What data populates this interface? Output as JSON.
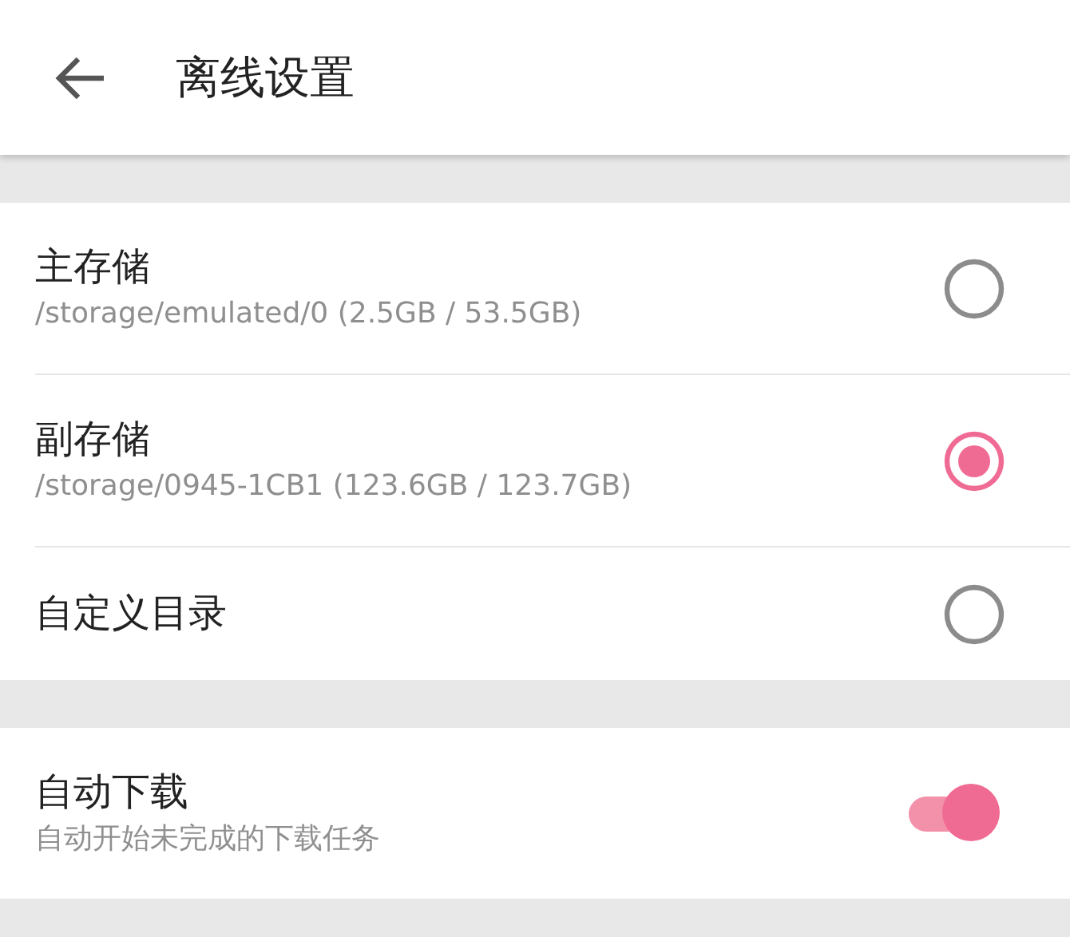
{
  "app_bar": {
    "title": "离线设置"
  },
  "storage_options": [
    {
      "title": "主存储",
      "subtitle": "/storage/emulated/0 (2.5GB / 53.5GB)",
      "selected": false
    },
    {
      "title": "副存储",
      "subtitle": "/storage/0945-1CB1 (123.6GB / 123.7GB)",
      "selected": true
    },
    {
      "title": "自定义目录",
      "selected": false
    }
  ],
  "auto_download": {
    "title": "自动下载",
    "subtitle": "自动开始未完成的下载任务",
    "on": true
  }
}
